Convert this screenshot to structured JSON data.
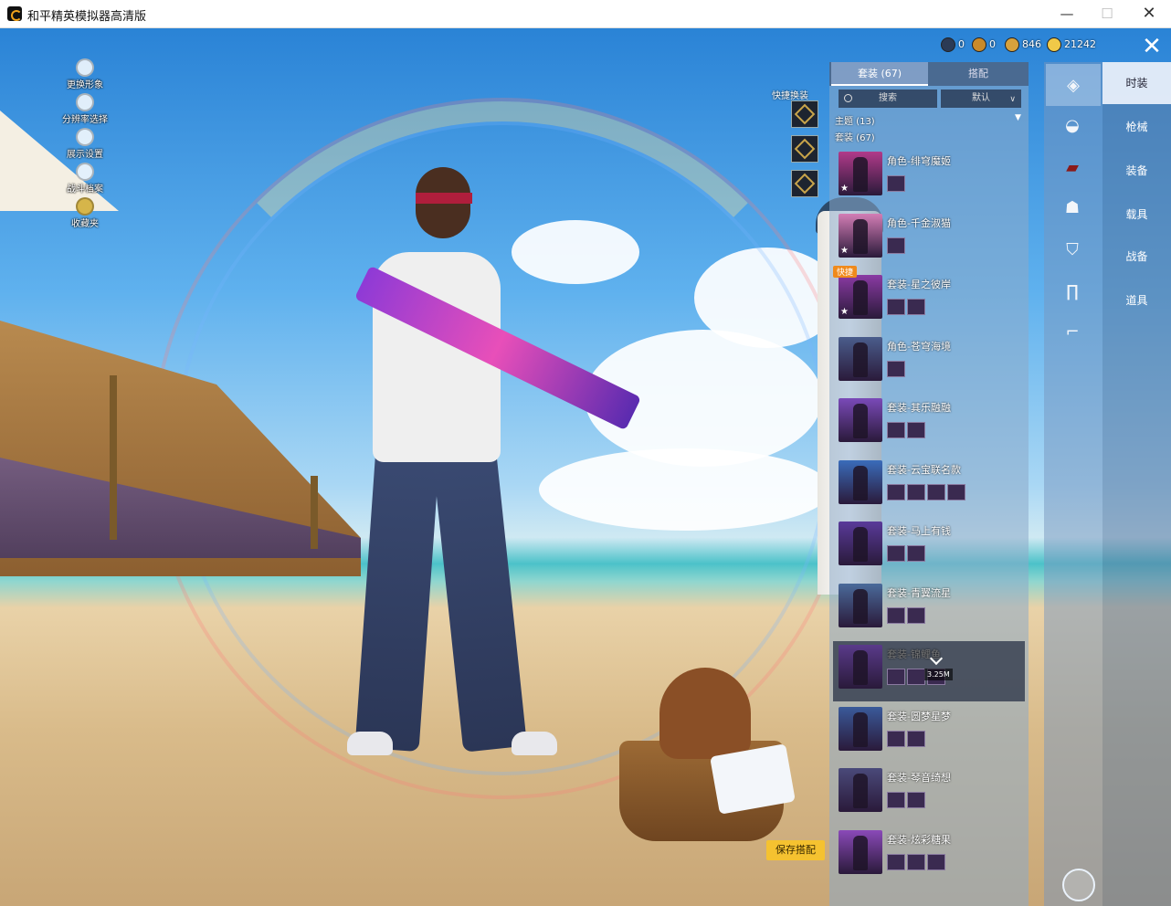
{
  "window": {
    "title": "和平精英模拟器高清版",
    "min": "—",
    "max": "☐",
    "close": "✕"
  },
  "left_menu": [
    {
      "label": "更换形象",
      "icon": "avatar-icon"
    },
    {
      "label": "分辨率选择",
      "icon": "resolution-icon"
    },
    {
      "label": "展示设置",
      "icon": "eye-icon"
    },
    {
      "label": "战斗档案",
      "icon": "profile-icon"
    },
    {
      "label": "收藏夹",
      "icon": "favorite-icon"
    }
  ],
  "quick_change": {
    "label": "快捷换装"
  },
  "currency": [
    {
      "value": "0",
      "color": "#2b3a55"
    },
    {
      "value": "0",
      "color": "#c98a2a"
    },
    {
      "value": "846",
      "color": "#d7a13c"
    },
    {
      "value": "21242",
      "color": "#f0c948"
    }
  ],
  "panel": {
    "tab_outfits": "套装 (67)",
    "tab_match": "搭配",
    "search_placeholder": "搜索",
    "sort_label": "默认",
    "category_theme": "主题 (13)",
    "category_outfits": "套装 (67)",
    "items": [
      {
        "name": "角色-绯穹魔姬",
        "parts": 1,
        "color": "#b13a8a"
      },
      {
        "name": "角色-千金淑猫",
        "parts": 1,
        "color": "#d37db5"
      },
      {
        "name": "套装-星之彼岸",
        "parts": 2,
        "color": "#8a3aa3",
        "quick": "快捷"
      },
      {
        "name": "角色-苍穹海境",
        "parts": 1,
        "color": "#4a5d8c"
      },
      {
        "name": "套装-其乐融融",
        "parts": 2,
        "color": "#7a4ab8"
      },
      {
        "name": "套装-云宝联名款",
        "parts": 4,
        "color": "#3a6cba"
      },
      {
        "name": "套装-马上有钱",
        "parts": 2,
        "color": "#5a3a9a"
      },
      {
        "name": "套装-青翼流星",
        "parts": 2,
        "color": "#4a6a9a"
      },
      {
        "name": "套装-锦鲤鱼",
        "parts": 3,
        "color": "#5a3a8a",
        "selected": true,
        "download": "3.25M"
      },
      {
        "name": "套装-圆梦星梦",
        "parts": 2,
        "color": "#3a5a9a"
      },
      {
        "name": "套装-琴音绮想",
        "parts": 2,
        "color": "#4a4a7a"
      },
      {
        "name": "套装-炫彩糖果",
        "parts": 3,
        "color": "#8a4ab8"
      }
    ]
  },
  "categories": [
    "hat-icon",
    "cap-icon",
    "mask-icon",
    "face-icon",
    "jacket-icon",
    "pants-icon",
    "shoes-icon"
  ],
  "side_nav": [
    "时装",
    "枪械",
    "装备",
    "载具",
    "战备",
    "道具"
  ],
  "save_label": "保存搭配"
}
